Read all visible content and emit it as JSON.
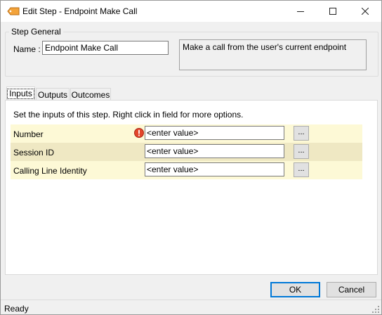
{
  "window": {
    "title": "Edit Step - Endpoint Make Call",
    "app_icon": "step-tag-icon",
    "controls": {
      "minimize": "minimize-icon",
      "maximize": "maximize-icon",
      "close": "close-icon"
    }
  },
  "step_general": {
    "caption": "Step General",
    "name_label": "Name :",
    "name_value": "Endpoint Make Call",
    "description": "Make a call from the user's current endpoint"
  },
  "tabs": [
    {
      "label": "Inputs",
      "active": true
    },
    {
      "label": "Outputs",
      "active": false
    },
    {
      "label": "Outcomes",
      "active": false
    }
  ],
  "inputs": {
    "hint": "Set the inputs of this step.  Right click in field for more options.",
    "rows": [
      {
        "label": "Number",
        "value": "<enter value>",
        "button": "...",
        "required_icon": "error-icon"
      },
      {
        "label": "Session ID",
        "value": "<enter value>",
        "button": "..."
      },
      {
        "label": "Calling Line Identity",
        "value": "<enter value>",
        "button": "..."
      }
    ]
  },
  "buttons": {
    "ok": "OK",
    "cancel": "Cancel"
  },
  "status": {
    "text": "Ready"
  },
  "colors": {
    "accent": "#0078d7",
    "row_light": "#fdf9d6",
    "row_dark": "#efe8c3",
    "error": "#e3462b"
  }
}
